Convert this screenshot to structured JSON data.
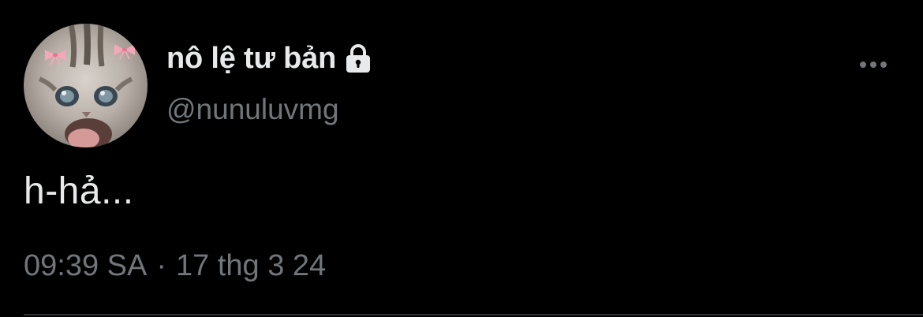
{
  "tweet": {
    "author": {
      "display_name": "nô lệ tư bản",
      "handle": "@nunuluvmg",
      "avatar_icon": "cat-avatar",
      "locked_icon": "lock-icon"
    },
    "more_icon": "more-horizontal-icon",
    "text": "h-hả...",
    "time": "09:39 SA",
    "separator": "·",
    "date": "17 thg 3 24"
  },
  "colors": {
    "background": "#000000",
    "primary_text": "#e7e9ea",
    "secondary_text": "#71767b",
    "divider": "#2f3336"
  }
}
